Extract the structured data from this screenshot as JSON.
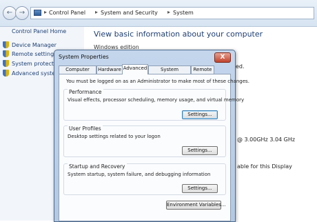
{
  "breadcrumb": [
    "Control Panel",
    "System and Security",
    "System"
  ],
  "sidebar": {
    "home": "Control Panel Home",
    "items": [
      {
        "label": "Device Manager"
      },
      {
        "label": "Remote settings"
      },
      {
        "label": "System protection"
      },
      {
        "label": "Advanced system"
      }
    ]
  },
  "main": {
    "title": "View basic information about your computer",
    "edition_heading": "Windows edition",
    "fragments": {
      "reserved": "ed.",
      "cpu": "@ 3.00GHz   3.04 GHz",
      "display": "able for this Display"
    }
  },
  "dialog": {
    "title": "System Properties",
    "close_label": "X",
    "tabs": [
      {
        "label": "Computer Name"
      },
      {
        "label": "Hardware"
      },
      {
        "label": "Advanced",
        "active": true
      },
      {
        "label": "System Protection"
      },
      {
        "label": "Remote"
      }
    ],
    "admin_note": "You must be logged on as an Administrator to make most of these changes.",
    "performance": {
      "title": "Performance",
      "desc": "Visual effects, processor scheduling, memory usage, and virtual memory",
      "button": "Settings..."
    },
    "user_profiles": {
      "title": "User Profiles",
      "desc": "Desktop settings related to your logon",
      "button": "Settings..."
    },
    "startup": {
      "title": "Startup and Recovery",
      "desc": "System startup, system failure, and debugging information",
      "button": "Settings..."
    },
    "env_button": "Environment Variables..."
  }
}
